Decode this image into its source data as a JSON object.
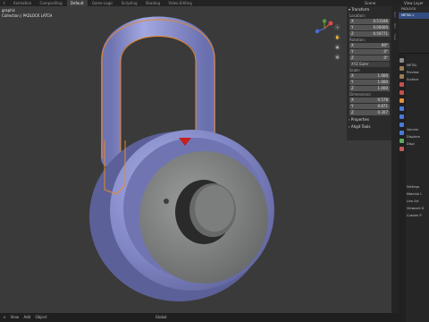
{
  "topbar": {
    "tabs": [
      "t",
      "Animation",
      "Compositing",
      "Default",
      "Game Logic",
      "Scripting",
      "Shading",
      "Video Editing"
    ],
    "active_tab": "Default",
    "scene_label": "Scene",
    "layer_label": "View Layer"
  },
  "viewport": {
    "info_line1": "graphic",
    "info_line2": "Collection | PADLOCK LATCH"
  },
  "n_panel": {
    "header": "Transform",
    "location_label": "Location:",
    "location": [
      {
        "axis": "X",
        "value": "0.51166"
      },
      {
        "axis": "Y",
        "value": "0.00000"
      },
      {
        "axis": "Z",
        "value": "0.50771"
      }
    ],
    "rotation_label": "Rotation:",
    "rotation": [
      {
        "axis": "X",
        "value": "90°"
      },
      {
        "axis": "Y",
        "value": "0°"
      },
      {
        "axis": "Z",
        "value": "0°"
      }
    ],
    "rotation_mode": "XYZ Euler",
    "scale_label": "Scale:",
    "scale": [
      {
        "axis": "X",
        "value": "1.000"
      },
      {
        "axis": "Y",
        "value": "1.000"
      },
      {
        "axis": "Z",
        "value": "1.000"
      }
    ],
    "dimensions_label": "Dimensions:",
    "dimensions": [
      {
        "axis": "X",
        "value": "0.578"
      },
      {
        "axis": "Y",
        "value": "0.871"
      },
      {
        "axis": "Z",
        "value": "0.307"
      }
    ],
    "properties_label": "Properties",
    "ahgit_label": "Ahgit Tools"
  },
  "side_tabs": [
    "Item",
    "Tool",
    "View"
  ],
  "statusbar": {
    "items": [
      "v",
      "View",
      "Add",
      "Object",
      "Global"
    ]
  },
  "properties_editor": {
    "outliner_rows": [
      "PADLOCK",
      "METAL L",
      "",
      "",
      ""
    ],
    "selected_row": 1,
    "panel_title": "METAL",
    "sections": [
      "Preview",
      "Surface",
      "",
      "",
      "",
      "",
      "",
      "",
      "Volume",
      "Displace",
      "Displ",
      "",
      "",
      "",
      "",
      "",
      "Settings",
      "Material L",
      "Line Art",
      "Viewport D",
      "Custom P"
    ]
  },
  "colors": {
    "viewport_bg": "#3a3a3a",
    "lock_body": "#8287c4",
    "selection_outline": "#e8882a",
    "active_tab_bg": "#3d3d3d",
    "selected_row": "#334d80"
  }
}
